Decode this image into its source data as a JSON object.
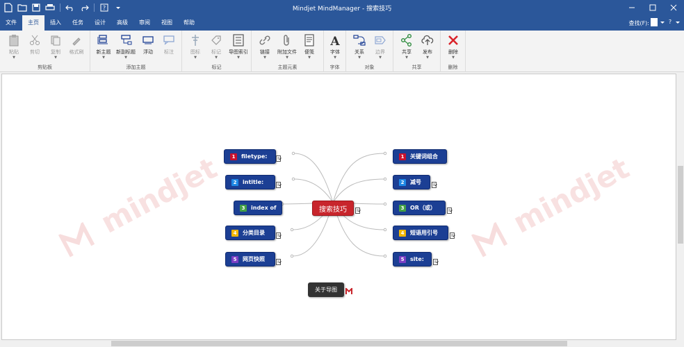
{
  "window": {
    "title": "Mindjet MindManager - 搜索技巧"
  },
  "tabs": [
    {
      "label": "文件"
    },
    {
      "label": "主页"
    },
    {
      "label": "插入"
    },
    {
      "label": "任务"
    },
    {
      "label": "设计"
    },
    {
      "label": "高级"
    },
    {
      "label": "审阅"
    },
    {
      "label": "视图"
    },
    {
      "label": "帮助"
    }
  ],
  "active_tab": "主页",
  "find_label": "查找(F):",
  "ribbon": {
    "clipboard": {
      "name": "剪贴板",
      "paste": "粘贴",
      "cut": "剪切",
      "copy": "复制",
      "format_painter": "格式刷"
    },
    "add_topic": {
      "name": "添加主题",
      "new_topic": "新主题",
      "new_subtopic": "新副标题",
      "floating": "浮动",
      "callout": "标注"
    },
    "markers": {
      "name": "标记",
      "icon": "图标",
      "tag": "标记",
      "map_index": "导图索引"
    },
    "topic_elements": {
      "name": "主题元素",
      "link": "链接",
      "attach": "附加文件",
      "notes": "便笺"
    },
    "font": {
      "name": "字体",
      "font": "字体"
    },
    "objects": {
      "name": "对象",
      "relation": "关系",
      "boundary": "边界"
    },
    "share": {
      "name": "共享",
      "share": "共享",
      "publish": "发布"
    },
    "delete": {
      "name": "删除",
      "delete": "删除"
    }
  },
  "colors": {
    "titlebar": "#2b579a",
    "topic": "#1c3f94",
    "central": "#c8252c",
    "floating": "#333333",
    "watermark": "#f3c9c9"
  },
  "watermark_text": "mindjet",
  "map": {
    "central": "搜索技巧",
    "left": [
      {
        "num": "1",
        "label": "filetype:",
        "color": "#c8102e"
      },
      {
        "num": "2",
        "label": "intitle:",
        "color": "#1e88e5"
      },
      {
        "num": "3",
        "label": "index of",
        "color": "#43a047"
      },
      {
        "num": "4",
        "label": "分类目录",
        "color": "#f2b705"
      },
      {
        "num": "5",
        "label": "网页快照",
        "color": "#7b3fc4"
      }
    ],
    "right": [
      {
        "num": "1",
        "label": "关键词组合",
        "color": "#c8102e"
      },
      {
        "num": "2",
        "label": "减号",
        "color": "#1e88e5"
      },
      {
        "num": "3",
        "label": "OR（或）",
        "color": "#43a047"
      },
      {
        "num": "4",
        "label": "短语用引号",
        "color": "#f2b705"
      },
      {
        "num": "5",
        "label": "site:",
        "color": "#7b3fc4"
      }
    ],
    "floating": "关于导图"
  }
}
